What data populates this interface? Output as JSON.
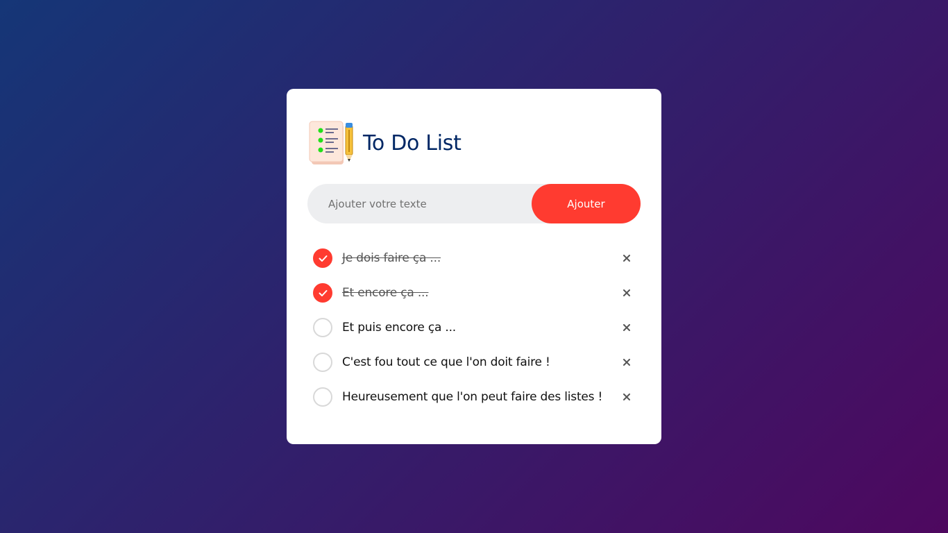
{
  "app": {
    "title": "To Do List",
    "logo_icon": "notepad-pencil-icon"
  },
  "colors": {
    "background_start": "#153677",
    "background_end": "#4e085f",
    "accent": "#ff3b30",
    "title": "#002765",
    "input_bg": "#edeef0"
  },
  "input": {
    "placeholder": "Ajouter votre texte",
    "value": ""
  },
  "add_button": {
    "label": "Ajouter"
  },
  "tasks": [
    {
      "text": "Je dois faire ça ...",
      "checked": true
    },
    {
      "text": "Et encore ça ...",
      "checked": true
    },
    {
      "text": "Et puis encore ça ...",
      "checked": false
    },
    {
      "text": "C'est fou tout ce que l'on doit faire !",
      "checked": false
    },
    {
      "text": "Heureusement que l'on peut faire des listes !",
      "checked": false
    }
  ]
}
